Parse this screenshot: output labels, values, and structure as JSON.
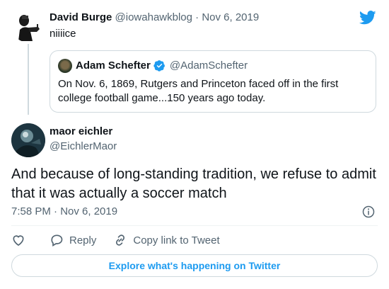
{
  "parent_tweet": {
    "display_name": "David Burge",
    "meta": "@iowahawkblog · Nov 6, 2019",
    "text": "niiiice"
  },
  "quoted_tweet": {
    "display_name": "Adam Schefter",
    "handle": "@AdamSchefter",
    "text": "On Nov. 6, 1869, Rutgers and Princeton faced off in the first college football game...150 years ago today."
  },
  "main_tweet": {
    "display_name": "maor eichler",
    "handle": "@EichlerMaor",
    "text": "And because of long-standing tradition, we refuse to admit that it was actually a soccer match",
    "timestamp": "7:58 PM · Nov 6, 2019"
  },
  "actions": {
    "reply_label": "Reply",
    "copy_link_label": "Copy link to Tweet"
  },
  "explore_label": "Explore what's happening on Twitter",
  "colors": {
    "twitter_blue": "#1d9bf0",
    "text_primary": "#0f1419",
    "text_secondary": "#536471",
    "border": "#cfd9de"
  },
  "icons": [
    "twitter-bird-icon",
    "verified-badge-icon",
    "info-icon",
    "heart-icon",
    "reply-icon",
    "link-icon"
  ]
}
